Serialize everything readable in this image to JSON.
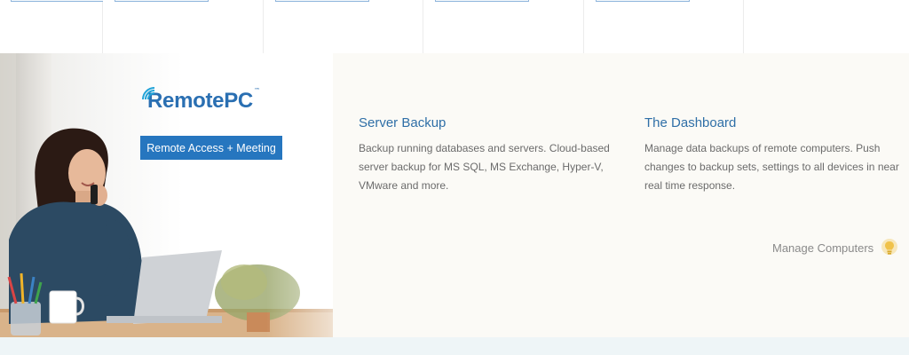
{
  "brand": {
    "name": "RemotePC",
    "tm": "™"
  },
  "cta": {
    "label": "Remote Access + Meeting"
  },
  "features": [
    {
      "title": "Server Backup",
      "desc": "Backup running databases and servers. Cloud-based server backup for MS SQL, MS Exchange, Hyper-V, VMware and more."
    },
    {
      "title": "The Dashboard",
      "desc": "Manage data backups of remote computers. Push changes to backup sets, settings to all devices in near real time response."
    }
  ],
  "manage_link": {
    "label": "Manage Computers"
  },
  "colors": {
    "brand_blue": "#2676bf",
    "title_blue": "#2f6fa7",
    "bulb": "#f0c24a",
    "band_bg": "#fbfaf6"
  },
  "icons": {
    "brand_mark": "wifi-wave-icon",
    "manage": "lightbulb-icon"
  }
}
